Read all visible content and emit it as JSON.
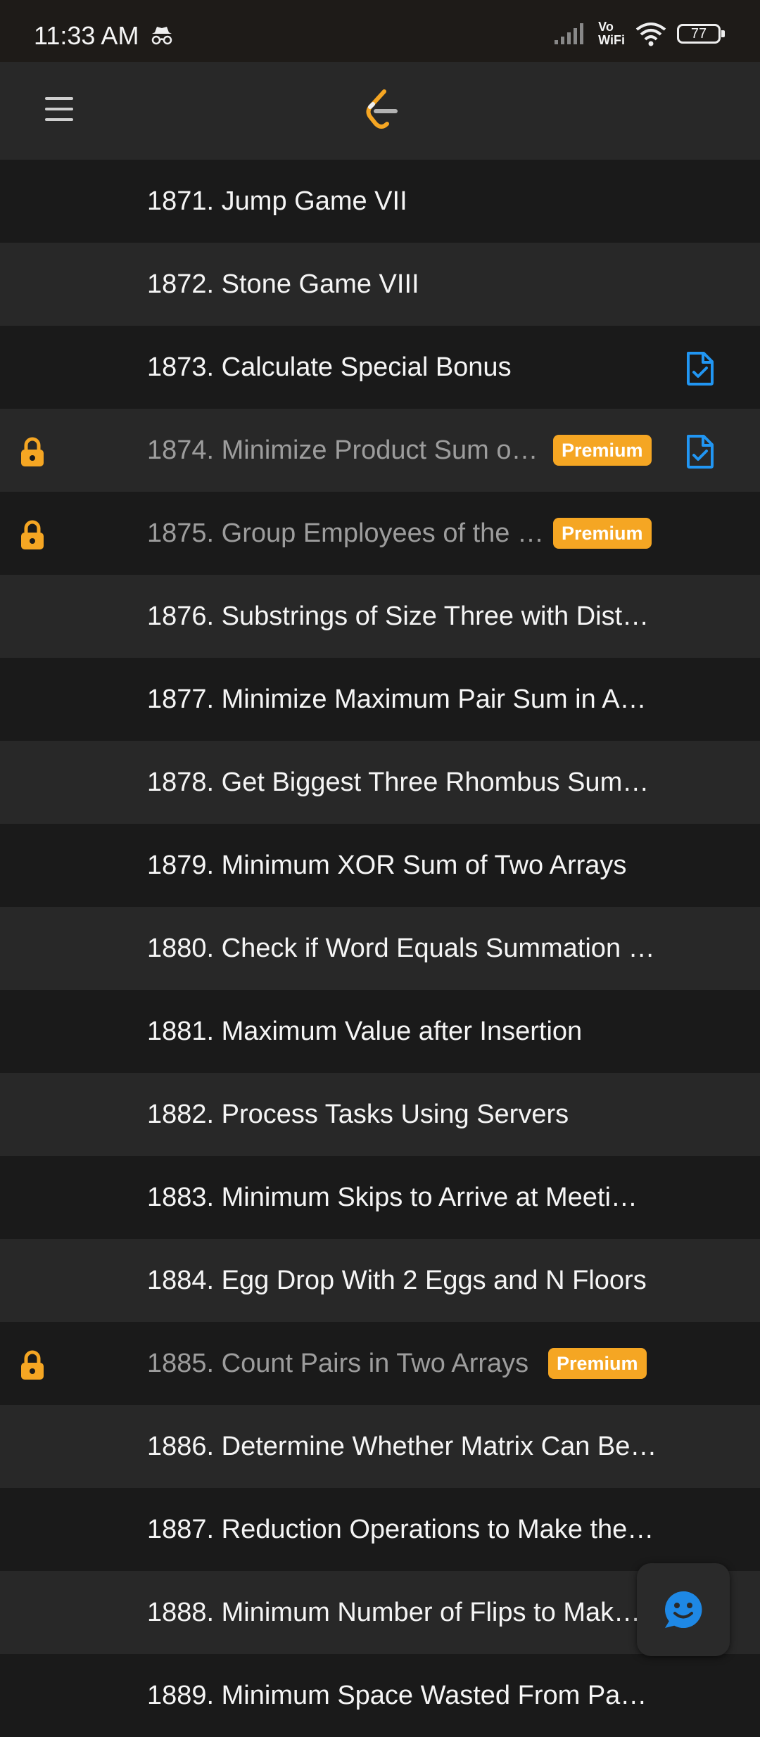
{
  "status_bar": {
    "time": "11:33 AM",
    "vowifi_top": "Vo",
    "vowifi_bottom": "WiFi",
    "battery": "77"
  },
  "colors": {
    "premium": "#f5a623",
    "lock": "#f5a623",
    "solved": "#2196f3",
    "row_dark": "#1a1a1a",
    "row_light": "#282828"
  },
  "problems": [
    {
      "title": "1871. Jump Game VII"
    },
    {
      "title": "1872. Stone Game VIII"
    },
    {
      "title": "1873. Calculate Special Bonus",
      "solved": true
    },
    {
      "title": "1874. Minimize Product Sum o…",
      "locked": true,
      "premium": "Premium",
      "solved": true
    },
    {
      "title": "1875. Group Employees of the …",
      "locked": true,
      "premium": "Premium"
    },
    {
      "title": "1876. Substrings of Size Three with Dist…"
    },
    {
      "title": "1877. Minimize Maximum Pair Sum in A…"
    },
    {
      "title": "1878. Get Biggest Three Rhombus Sum…"
    },
    {
      "title": "1879. Minimum XOR Sum of Two Arrays"
    },
    {
      "title": "1880. Check if Word Equals Summation …"
    },
    {
      "title": "1881. Maximum Value after Insertion"
    },
    {
      "title": "1882. Process Tasks Using Servers"
    },
    {
      "title": "1883. Minimum Skips to Arrive at Meeti…"
    },
    {
      "title": "1884. Egg Drop With 2 Eggs and N Floors"
    },
    {
      "title": "1885. Count Pairs in Two Arrays",
      "locked": true,
      "premium": "Premium"
    },
    {
      "title": "1886. Determine Whether Matrix Can Be…"
    },
    {
      "title": "1887. Reduction Operations to Make the…"
    },
    {
      "title": "1888. Minimum Number of Flips to Mak…"
    },
    {
      "title": "1889. Minimum Space Wasted From Pa…"
    }
  ]
}
